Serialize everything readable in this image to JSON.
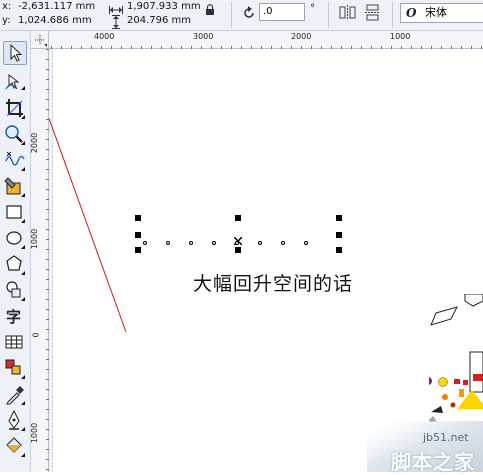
{
  "property_bar": {
    "x_label": "x:",
    "x_value": "-2,631.117 mm",
    "y_label": "y:",
    "y_value": "1,024.686 mm",
    "width_value": "1,907.933 mm",
    "height_value": "204.796 mm",
    "rotation_value": ".0",
    "degree_symbol": "°",
    "font_name": "宋体",
    "font_icon": "O"
  },
  "ruler_top": {
    "labels": [
      "4000",
      "3000",
      "2000",
      "1000"
    ]
  },
  "ruler_left": {
    "labels": [
      "2000",
      "1000",
      "0",
      "1000"
    ]
  },
  "canvas": {
    "text": "大幅回升空间的话"
  },
  "watermark": {
    "site": "jb51.net",
    "name": "脚本之家"
  },
  "toolbox": {
    "tools": [
      "pick-tool",
      "shape-tool",
      "crop-tool",
      "zoom-tool",
      "freehand-tool",
      "smart-fill-tool",
      "rectangle-tool",
      "ellipse-tool",
      "polygon-tool",
      "basic-shapes-tool",
      "text-tool",
      "table-tool",
      "blend-tool",
      "eyedropper-tool",
      "outline-tool",
      "fill-tool"
    ]
  },
  "colors": {
    "arrow": "#d01818",
    "panel_bg": "#eef2f8"
  }
}
